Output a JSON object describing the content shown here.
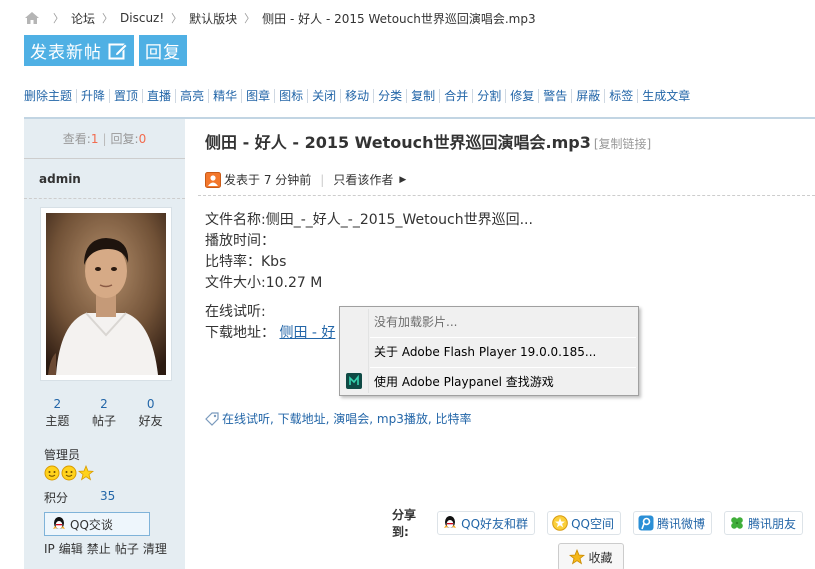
{
  "breadcrumb": {
    "items": [
      "论坛",
      "Discuz!",
      "默认版块",
      "侧田 - 好人 - 2015 Wetouch世界巡回演唱会.mp3"
    ]
  },
  "actions": {
    "new_thread": "发表新帖",
    "reply": "回复"
  },
  "modbar": {
    "items": [
      "删除主题",
      "升降",
      "置顶",
      "直播",
      "高亮",
      "精华",
      "图章",
      "图标",
      "关闭",
      "移动",
      "分类",
      "复制",
      "合并",
      "分割",
      "修复",
      "警告",
      "屏蔽",
      "标签",
      "生成文章"
    ]
  },
  "sidebar": {
    "views_label": "查看:",
    "views": "1",
    "replies_label": "回复:",
    "replies": "0",
    "author": "admin",
    "counts": [
      {
        "num": "2",
        "label": "主题"
      },
      {
        "num": "2",
        "label": "帖子"
      },
      {
        "num": "0",
        "label": "好友"
      }
    ],
    "group": "管理员",
    "points_label": "积分",
    "points": "35",
    "qq_label": "QQ交谈",
    "admin_links": [
      "IP",
      "编辑",
      "禁止",
      "帖子",
      "清理"
    ]
  },
  "post": {
    "title": "侧田 - 好人 - 2015 Wetouch世界巡回演唱会.mp3",
    "copy_link": "[复制链接]",
    "posted": "发表于 7 分钟前",
    "only_author": "只看该作者",
    "file_name": "文件名称:侧田_-_好人_-_2015_Wetouch世界巡回...",
    "duration": "播放时间：",
    "bitrate": "比特率：Kbs",
    "file_size": "文件大小:10.27 M",
    "listen": "在线试听:",
    "download_label": "下载地址：",
    "download_link": "侧田 - 好",
    "tags": "在线试听, 下载地址, 演唱会, mp3播放, 比特率"
  },
  "share": {
    "label": "分享到:",
    "targets": [
      "QQ好友和群",
      "QQ空间",
      "腾讯微博",
      "腾讯朋友"
    ],
    "favorite": "收藏"
  },
  "context_menu": {
    "items": [
      "没有加载影片...",
      "关于 Adobe Flash Player 19.0.0.185...",
      "使用 Adobe Playpanel 查找游戏"
    ]
  },
  "colors": {
    "accent": "#4fb0e4",
    "link": "#2366a8",
    "sidebar_bg": "#e5edf2",
    "red_count": "#f26c4f"
  }
}
